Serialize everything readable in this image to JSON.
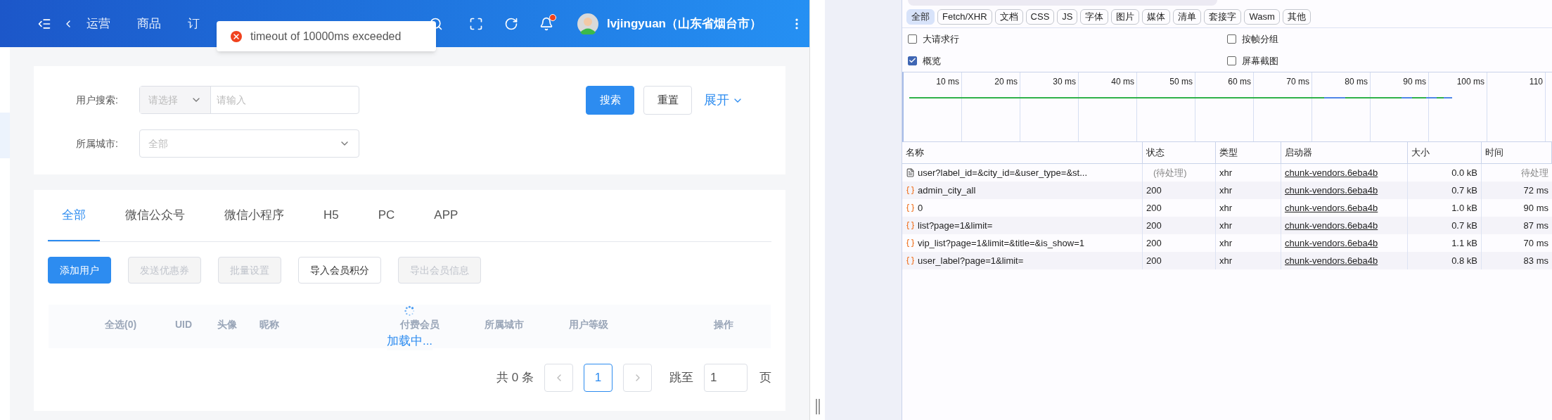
{
  "header": {
    "nav": [
      "运营",
      "商品",
      "订"
    ],
    "user": "lvjingyuan（山东省烟台市）",
    "has_notification": true
  },
  "toast": {
    "kind": "error",
    "message": "timeout of 10000ms exceeded"
  },
  "search_form": {
    "fields": [
      {
        "label": "用户搜索:",
        "kind": "select-input",
        "select_placeholder": "请选择",
        "placeholder": "请输入"
      },
      {
        "label": "所属城市:",
        "kind": "select",
        "placeholder": "全部"
      }
    ],
    "buttons": [
      {
        "label": "搜索",
        "kind": "primary"
      },
      {
        "label": "重置",
        "kind": "default"
      }
    ],
    "expand_link": "展开"
  },
  "tabs": [
    {
      "label": "全部",
      "selected": true
    },
    {
      "label": "微信公众号",
      "selected": false
    },
    {
      "label": "微信小程序",
      "selected": false
    },
    {
      "label": "H5",
      "selected": false
    },
    {
      "label": "PC",
      "selected": false
    },
    {
      "label": "APP",
      "selected": false
    }
  ],
  "actions": [
    {
      "label": "添加用户",
      "kind": "primary",
      "disabled": false
    },
    {
      "label": "发送优惠券",
      "kind": "default",
      "disabled": true
    },
    {
      "label": "批量设置",
      "kind": "default",
      "disabled": true
    },
    {
      "label": "导入会员积分",
      "kind": "default",
      "disabled": false
    },
    {
      "label": "导出会员信息",
      "kind": "default",
      "disabled": true
    }
  ],
  "table": {
    "columns": [
      "全选(0)",
      "UID",
      "头像",
      "昵称",
      "付费会员",
      "所属城市",
      "用户等级",
      "操作"
    ],
    "loading_text": "加载中..."
  },
  "pagination": {
    "total": "共 0 条",
    "pages": [
      {
        "label": "1",
        "selected": true
      }
    ],
    "jump_label": "跳至",
    "jump_value": "1",
    "page_unit": "页"
  },
  "devtools": {
    "filters": [
      {
        "label": "全部",
        "selected": true
      },
      {
        "label": "Fetch/XHR",
        "selected": false
      },
      {
        "label": "文档",
        "selected": false
      },
      {
        "label": "CSS",
        "selected": false
      },
      {
        "label": "JS",
        "selected": false
      },
      {
        "label": "字体",
        "selected": false
      },
      {
        "label": "图片",
        "selected": false
      },
      {
        "label": "媒体",
        "selected": false
      },
      {
        "label": "清单",
        "selected": false
      },
      {
        "label": "套接字",
        "selected": false
      },
      {
        "label": "Wasm",
        "selected": false
      },
      {
        "label": "其他",
        "selected": false
      }
    ],
    "options": [
      {
        "label": "大请求行",
        "checked": false
      },
      {
        "label": "按帧分组",
        "checked": false
      },
      {
        "label": "概览",
        "checked": true
      },
      {
        "label": "屏幕截图",
        "checked": false
      }
    ],
    "timeline_ticks": [
      "10 ms",
      "20 ms",
      "30 ms",
      "40 ms",
      "50 ms",
      "60 ms",
      "70 ms",
      "80 ms",
      "90 ms",
      "100 ms",
      "110"
    ],
    "columns": [
      "名称",
      "状态",
      "类型",
      "启动器",
      "大小",
      "时间"
    ],
    "requests": [
      {
        "kind": "document",
        "name": "user?label_id=&city_id=&user_type=&st...",
        "status": "(待处理)",
        "type": "xhr",
        "initiator": "chunk-vendors.6eba4b",
        "size": "0.0 kB",
        "time": "待处理",
        "pending": true
      },
      {
        "kind": "fetch",
        "name": "admin_city_all",
        "status": "200",
        "type": "xhr",
        "initiator": "chunk-vendors.6eba4b",
        "size": "0.7 kB",
        "time": "72 ms",
        "pending": false
      },
      {
        "kind": "fetch",
        "name": "0",
        "status": "200",
        "type": "xhr",
        "initiator": "chunk-vendors.6eba4b",
        "size": "1.0 kB",
        "time": "90 ms",
        "pending": false
      },
      {
        "kind": "fetch",
        "name": "list?page=1&limit=",
        "status": "200",
        "type": "xhr",
        "initiator": "chunk-vendors.6eba4b",
        "size": "0.7 kB",
        "time": "87 ms",
        "pending": false
      },
      {
        "kind": "fetch",
        "name": "vip_list?page=1&limit=&title=&is_show=1",
        "status": "200",
        "type": "xhr",
        "initiator": "chunk-vendors.6eba4b",
        "size": "1.1 kB",
        "time": "70 ms",
        "pending": false
      },
      {
        "kind": "fetch",
        "name": "user_label?page=1&limit=",
        "status": "200",
        "type": "xhr",
        "initiator": "chunk-vendors.6eba4b",
        "size": "0.8 kB",
        "time": "83 ms",
        "pending": false
      }
    ]
  }
}
